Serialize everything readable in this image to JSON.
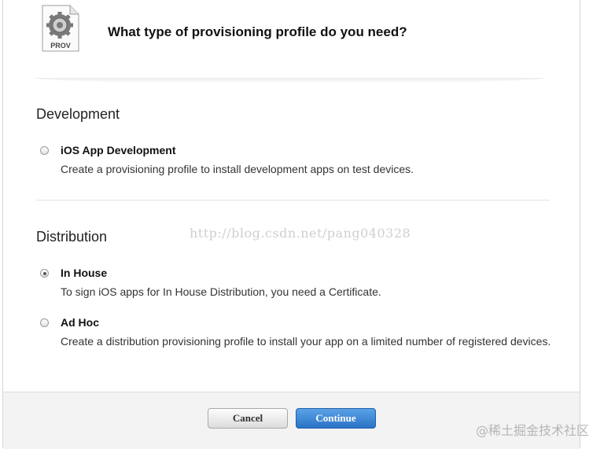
{
  "header": {
    "icon_label": "PROV",
    "title": "What type of provisioning profile do you need?"
  },
  "sections": [
    {
      "title": "Development",
      "options": [
        {
          "label": "iOS App Development",
          "description": "Create a provisioning profile to install development apps on test devices.",
          "selected": false
        }
      ]
    },
    {
      "title": "Distribution",
      "options": [
        {
          "label": "In House",
          "description": "To sign iOS apps for In House Distribution, you need a Certificate.",
          "selected": true
        },
        {
          "label": "Ad Hoc",
          "description": "Create a distribution provisioning profile to install your app on a limited number of registered devices.",
          "selected": false
        }
      ]
    }
  ],
  "watermark_text": "http://blog.csdn.net/pang040328",
  "footer": {
    "cancel_label": "Cancel",
    "continue_label": "Continue"
  },
  "brand_watermark": "@稀土掘金技术社区",
  "colors": {
    "primary_button": "#2a73c6",
    "footer_bg": "#f3f3f3"
  }
}
